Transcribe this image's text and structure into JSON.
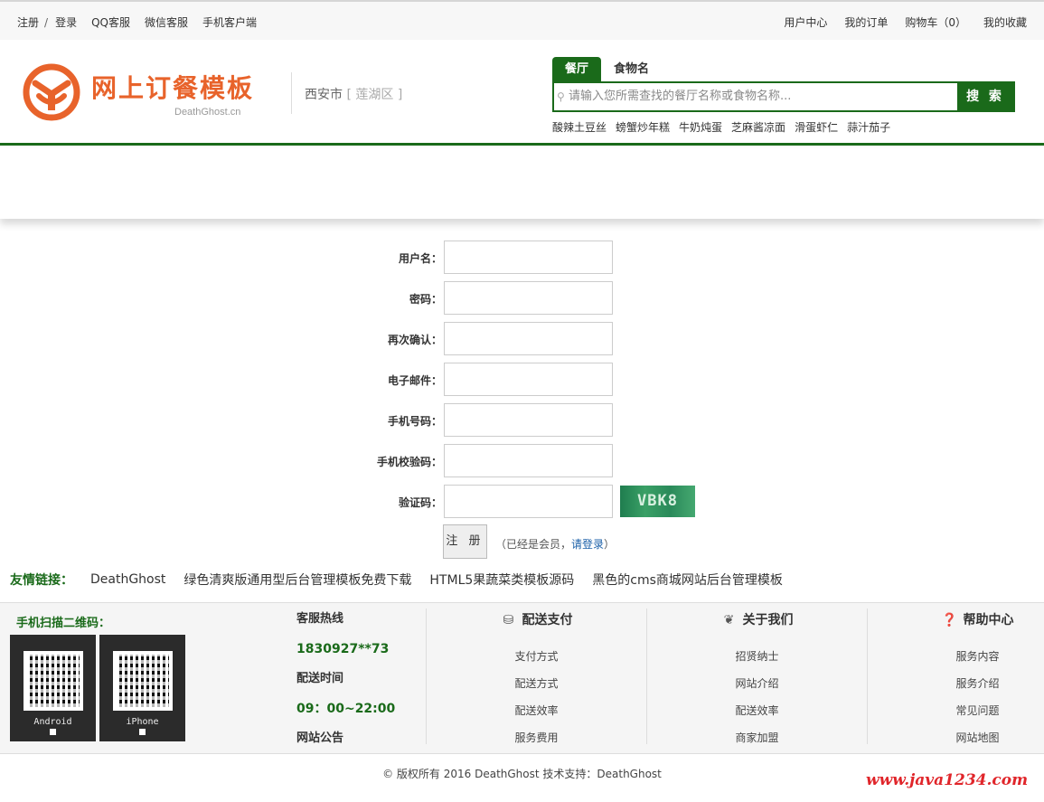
{
  "topbar": {
    "register": "注册",
    "sep": "/",
    "login": "登录",
    "qq": "QQ客服",
    "wechat": "微信客服",
    "mobile": "手机客户端",
    "user_center": "用户中心",
    "orders": "我的订单",
    "cart": "购物车（0）",
    "favorites": "我的收藏"
  },
  "header": {
    "logo_text": "网上订餐模板",
    "logo_sub": "DeathGhost.cn",
    "city": "西安市",
    "district": "[ 莲湖区 ]",
    "search": {
      "tabs": [
        "餐厅",
        "食物名"
      ],
      "placeholder": "请输入您所需查找的餐厅名称或食物名称...",
      "button": "搜 索",
      "hot_words": [
        "酸辣土豆丝",
        "螃蟹炒年糕",
        "牛奶炖蛋",
        "芝麻酱凉面",
        "滑蛋虾仁",
        "蒜汁茄子"
      ]
    }
  },
  "form": {
    "username_label": "用户名：",
    "password_label": "密码：",
    "confirm_label": "再次确认：",
    "email_label": "电子邮件：",
    "phone_label": "手机号码：",
    "sms_label": "手机校验码：",
    "captcha_label": "验证码：",
    "captcha_text": "VBK8",
    "submit": "注 册",
    "member_tip_pre": "（已经是会员，",
    "member_tip_link": "请登录",
    "member_tip_post": "）"
  },
  "friend_links": {
    "label": "友情链接：",
    "items": [
      "DeathGhost",
      "绿色清爽版通用型后台管理模板免费下载",
      "HTML5果蔬菜类模板源码",
      "黑色的cms商城网站后台管理模板"
    ]
  },
  "footer": {
    "qr_title": "手机扫描二维码：",
    "qr_android": "Android",
    "qr_iphone": "iPhone",
    "hotline_title": "客服热线",
    "hotline": "1830927**73",
    "delivery_time_title": "配送时间",
    "delivery_time": "09：00~22:00",
    "notice": "网站公告",
    "columns": [
      {
        "title": "配送支付",
        "icon": "bicycle-icon",
        "items": [
          "支付方式",
          "配送方式",
          "配送效率",
          "服务费用"
        ]
      },
      {
        "title": "关于我们",
        "icon": "leaf-icon",
        "items": [
          "招贤纳士",
          "网站介绍",
          "配送效率",
          "商家加盟"
        ]
      },
      {
        "title": "帮助中心",
        "icon": "question-icon",
        "items": [
          "服务内容",
          "服务介绍",
          "常见问题",
          "网站地图"
        ]
      }
    ],
    "copyright": "© 版权所有 2016 DeathGhost 技术支持：DeathGhost",
    "watermark": "www.java1234.com"
  },
  "colors": {
    "brand_green": "#1a6a1a",
    "logo_orange": "#e8632b",
    "watermark_red": "#e0252a",
    "link_blue": "#1a5fa8"
  }
}
